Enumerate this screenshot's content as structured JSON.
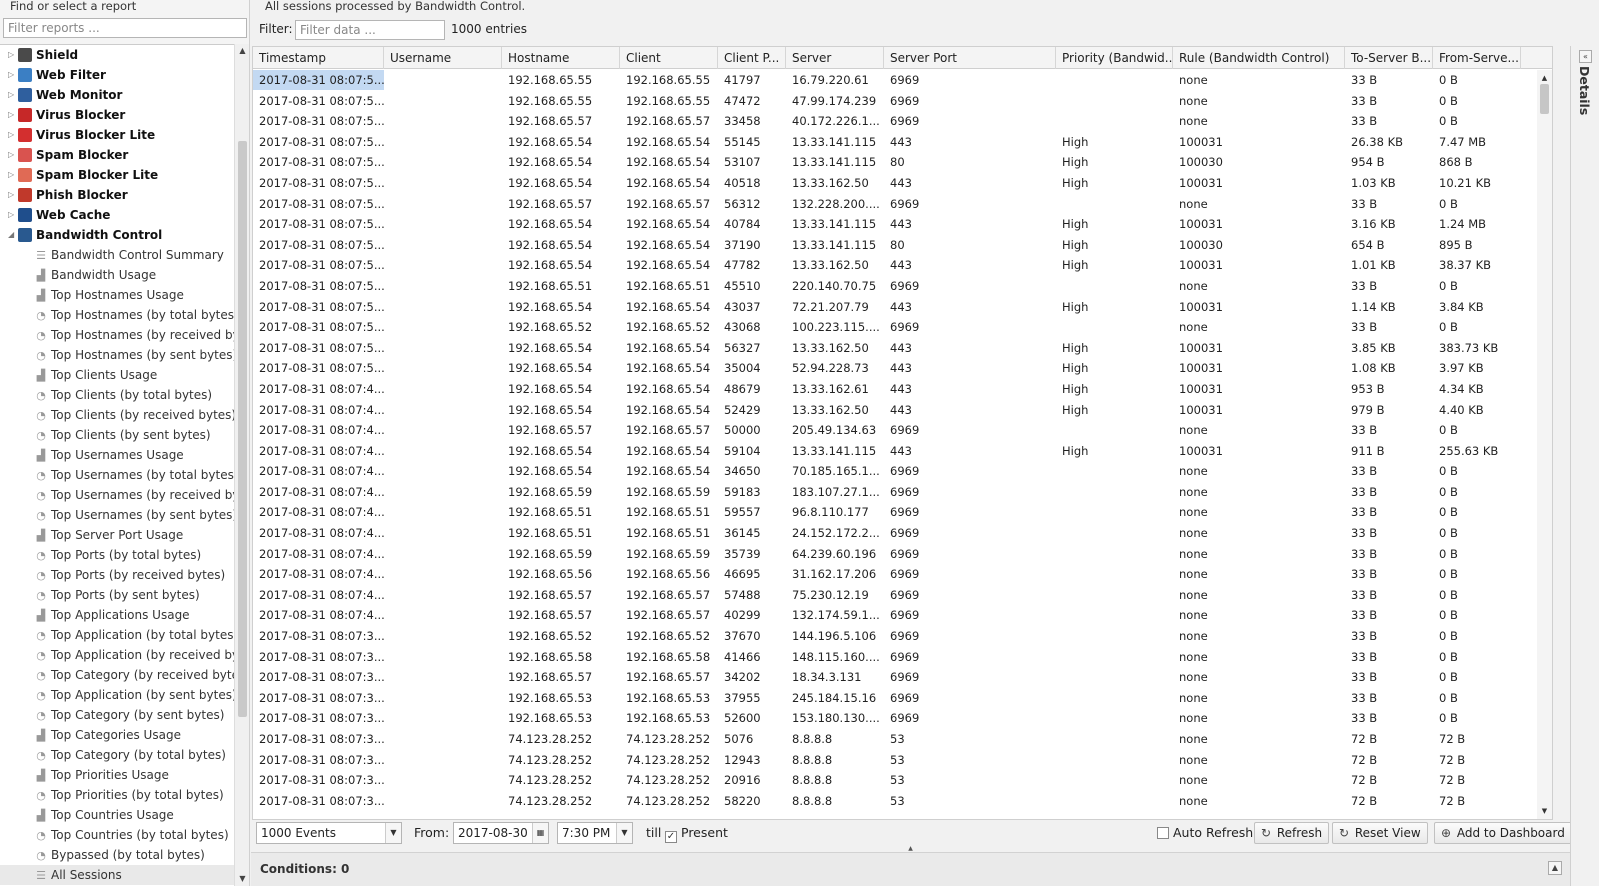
{
  "sidebar": {
    "find_label": "Find or select a report",
    "filter_placeholder": "Filter reports ...",
    "apps": [
      {
        "name": "Shield",
        "color": "#4a4a4a",
        "expanded": false
      },
      {
        "name": "Web Filter",
        "color": "#3b7fc4",
        "expanded": false
      },
      {
        "name": "Web Monitor",
        "color": "#2f5f9e",
        "expanded": false
      },
      {
        "name": "Virus Blocker",
        "color": "#c62828",
        "expanded": false
      },
      {
        "name": "Virus Blocker Lite",
        "color": "#d32f2f",
        "expanded": false
      },
      {
        "name": "Spam Blocker",
        "color": "#d9534f",
        "expanded": false
      },
      {
        "name": "Spam Blocker Lite",
        "color": "#e06a55",
        "expanded": false
      },
      {
        "name": "Phish Blocker",
        "color": "#c0392b",
        "expanded": false
      },
      {
        "name": "Web Cache",
        "color": "#1f4e8c",
        "expanded": false
      },
      {
        "name": "Bandwidth Control",
        "color": "#29598f",
        "expanded": true
      }
    ],
    "reports": [
      {
        "label": "Bandwidth Control Summary",
        "icon": "list-icon"
      },
      {
        "label": "Bandwidth Usage",
        "icon": "area-chart-icon"
      },
      {
        "label": "Top Hostnames Usage",
        "icon": "area-chart-icon"
      },
      {
        "label": "Top Hostnames (by total bytes)",
        "icon": "pie-chart-icon"
      },
      {
        "label": "Top Hostnames (by received byte...",
        "icon": "pie-chart-icon"
      },
      {
        "label": "Top Hostnames (by sent bytes)",
        "icon": "pie-chart-icon"
      },
      {
        "label": "Top Clients Usage",
        "icon": "area-chart-icon"
      },
      {
        "label": "Top Clients (by total bytes)",
        "icon": "pie-chart-icon"
      },
      {
        "label": "Top Clients (by received bytes)",
        "icon": "pie-chart-icon"
      },
      {
        "label": "Top Clients (by sent bytes)",
        "icon": "pie-chart-icon"
      },
      {
        "label": "Top Usernames Usage",
        "icon": "area-chart-icon"
      },
      {
        "label": "Top Usernames (by total bytes)",
        "icon": "pie-chart-icon"
      },
      {
        "label": "Top Usernames (by received bytes)",
        "icon": "pie-chart-icon"
      },
      {
        "label": "Top Usernames (by sent bytes)",
        "icon": "pie-chart-icon"
      },
      {
        "label": "Top Server Port Usage",
        "icon": "area-chart-icon"
      },
      {
        "label": "Top Ports (by total bytes)",
        "icon": "pie-chart-icon"
      },
      {
        "label": "Top Ports (by received bytes)",
        "icon": "pie-chart-icon"
      },
      {
        "label": "Top Ports (by sent bytes)",
        "icon": "pie-chart-icon"
      },
      {
        "label": "Top Applications Usage",
        "icon": "area-chart-icon"
      },
      {
        "label": "Top Application (by total bytes)",
        "icon": "pie-chart-icon"
      },
      {
        "label": "Top Application (by received bytes)",
        "icon": "pie-chart-icon"
      },
      {
        "label": "Top Category (by received bytes)",
        "icon": "pie-chart-icon"
      },
      {
        "label": "Top Application (by sent bytes)",
        "icon": "pie-chart-icon"
      },
      {
        "label": "Top Category (by sent bytes)",
        "icon": "pie-chart-icon"
      },
      {
        "label": "Top Categories Usage",
        "icon": "area-chart-icon"
      },
      {
        "label": "Top Category (by total bytes)",
        "icon": "pie-chart-icon"
      },
      {
        "label": "Top Priorities Usage",
        "icon": "area-chart-icon"
      },
      {
        "label": "Top Priorities (by total bytes)",
        "icon": "pie-chart-icon"
      },
      {
        "label": "Top Countries Usage",
        "icon": "area-chart-icon"
      },
      {
        "label": "Top Countries (by total bytes)",
        "icon": "pie-chart-icon"
      },
      {
        "label": "Bypassed (by total bytes)",
        "icon": "pie-chart-icon"
      },
      {
        "label": "All Sessions",
        "icon": "list-icon",
        "selected": true
      }
    ]
  },
  "main": {
    "description": "All sessions processed by Bandwidth Control.",
    "filter_label": "Filter:",
    "filter_placeholder": "Filter data ...",
    "entries": "1000 entries"
  },
  "table": {
    "columns": [
      "Timestamp",
      "Username",
      "Hostname",
      "Client",
      "Client P...",
      "Server",
      "Server Port",
      "Priority (Bandwid...",
      "Rule (Bandwidth Control)",
      "To-Server B...",
      "From-Serve..."
    ],
    "rows": [
      [
        "2017-08-31 08:07:5...",
        "",
        "192.168.65.55",
        "192.168.65.55",
        "41797",
        "16.79.220.61",
        "6969",
        "",
        "none",
        "33 B",
        "0 B"
      ],
      [
        "2017-08-31 08:07:5...",
        "",
        "192.168.65.55",
        "192.168.65.55",
        "47472",
        "47.99.174.239",
        "6969",
        "",
        "none",
        "33 B",
        "0 B"
      ],
      [
        "2017-08-31 08:07:5...",
        "",
        "192.168.65.57",
        "192.168.65.57",
        "33458",
        "40.172.226.1...",
        "6969",
        "",
        "none",
        "33 B",
        "0 B"
      ],
      [
        "2017-08-31 08:07:5...",
        "",
        "192.168.65.54",
        "192.168.65.54",
        "55145",
        "13.33.141.115",
        "443",
        "High",
        "100031",
        "26.38 KB",
        "7.47 MB"
      ],
      [
        "2017-08-31 08:07:5...",
        "",
        "192.168.65.54",
        "192.168.65.54",
        "53107",
        "13.33.141.115",
        "80",
        "High",
        "100030",
        "954 B",
        "868 B"
      ],
      [
        "2017-08-31 08:07:5...",
        "",
        "192.168.65.54",
        "192.168.65.54",
        "40518",
        "13.33.162.50",
        "443",
        "High",
        "100031",
        "1.03 KB",
        "10.21 KB"
      ],
      [
        "2017-08-31 08:07:5...",
        "",
        "192.168.65.57",
        "192.168.65.57",
        "56312",
        "132.228.200....",
        "6969",
        "",
        "none",
        "33 B",
        "0 B"
      ],
      [
        "2017-08-31 08:07:5...",
        "",
        "192.168.65.54",
        "192.168.65.54",
        "40784",
        "13.33.141.115",
        "443",
        "High",
        "100031",
        "3.16 KB",
        "1.24 MB"
      ],
      [
        "2017-08-31 08:07:5...",
        "",
        "192.168.65.54",
        "192.168.65.54",
        "37190",
        "13.33.141.115",
        "80",
        "High",
        "100030",
        "654 B",
        "895 B"
      ],
      [
        "2017-08-31 08:07:5...",
        "",
        "192.168.65.54",
        "192.168.65.54",
        "47782",
        "13.33.162.50",
        "443",
        "High",
        "100031",
        "1.01 KB",
        "38.37 KB"
      ],
      [
        "2017-08-31 08:07:5...",
        "",
        "192.168.65.51",
        "192.168.65.51",
        "45510",
        "220.140.70.75",
        "6969",
        "",
        "none",
        "33 B",
        "0 B"
      ],
      [
        "2017-08-31 08:07:5...",
        "",
        "192.168.65.54",
        "192.168.65.54",
        "43037",
        "72.21.207.79",
        "443",
        "High",
        "100031",
        "1.14 KB",
        "3.84 KB"
      ],
      [
        "2017-08-31 08:07:5...",
        "",
        "192.168.65.52",
        "192.168.65.52",
        "43068",
        "100.223.115....",
        "6969",
        "",
        "none",
        "33 B",
        "0 B"
      ],
      [
        "2017-08-31 08:07:5...",
        "",
        "192.168.65.54",
        "192.168.65.54",
        "56327",
        "13.33.162.50",
        "443",
        "High",
        "100031",
        "3.85 KB",
        "383.73 KB"
      ],
      [
        "2017-08-31 08:07:5...",
        "",
        "192.168.65.54",
        "192.168.65.54",
        "35004",
        "52.94.228.73",
        "443",
        "High",
        "100031",
        "1.08 KB",
        "3.97 KB"
      ],
      [
        "2017-08-31 08:07:4...",
        "",
        "192.168.65.54",
        "192.168.65.54",
        "48679",
        "13.33.162.61",
        "443",
        "High",
        "100031",
        "953 B",
        "4.34 KB"
      ],
      [
        "2017-08-31 08:07:4...",
        "",
        "192.168.65.54",
        "192.168.65.54",
        "52429",
        "13.33.162.50",
        "443",
        "High",
        "100031",
        "979 B",
        "4.40 KB"
      ],
      [
        "2017-08-31 08:07:4...",
        "",
        "192.168.65.57",
        "192.168.65.57",
        "50000",
        "205.49.134.63",
        "6969",
        "",
        "none",
        "33 B",
        "0 B"
      ],
      [
        "2017-08-31 08:07:4...",
        "",
        "192.168.65.54",
        "192.168.65.54",
        "59104",
        "13.33.141.115",
        "443",
        "High",
        "100031",
        "911 B",
        "255.63 KB"
      ],
      [
        "2017-08-31 08:07:4...",
        "",
        "192.168.65.54",
        "192.168.65.54",
        "34650",
        "70.185.165.1...",
        "6969",
        "",
        "none",
        "33 B",
        "0 B"
      ],
      [
        "2017-08-31 08:07:4...",
        "",
        "192.168.65.59",
        "192.168.65.59",
        "59183",
        "183.107.27.1...",
        "6969",
        "",
        "none",
        "33 B",
        "0 B"
      ],
      [
        "2017-08-31 08:07:4...",
        "",
        "192.168.65.51",
        "192.168.65.51",
        "59557",
        "96.8.110.177",
        "6969",
        "",
        "none",
        "33 B",
        "0 B"
      ],
      [
        "2017-08-31 08:07:4...",
        "",
        "192.168.65.51",
        "192.168.65.51",
        "36145",
        "24.152.172.2...",
        "6969",
        "",
        "none",
        "33 B",
        "0 B"
      ],
      [
        "2017-08-31 08:07:4...",
        "",
        "192.168.65.59",
        "192.168.65.59",
        "35739",
        "64.239.60.196",
        "6969",
        "",
        "none",
        "33 B",
        "0 B"
      ],
      [
        "2017-08-31 08:07:4...",
        "",
        "192.168.65.56",
        "192.168.65.56",
        "46695",
        "31.162.17.206",
        "6969",
        "",
        "none",
        "33 B",
        "0 B"
      ],
      [
        "2017-08-31 08:07:4...",
        "",
        "192.168.65.57",
        "192.168.65.57",
        "57488",
        "75.230.12.19",
        "6969",
        "",
        "none",
        "33 B",
        "0 B"
      ],
      [
        "2017-08-31 08:07:4...",
        "",
        "192.168.65.57",
        "192.168.65.57",
        "40299",
        "132.174.59.1...",
        "6969",
        "",
        "none",
        "33 B",
        "0 B"
      ],
      [
        "2017-08-31 08:07:3...",
        "",
        "192.168.65.52",
        "192.168.65.52",
        "37670",
        "144.196.5.106",
        "6969",
        "",
        "none",
        "33 B",
        "0 B"
      ],
      [
        "2017-08-31 08:07:3...",
        "",
        "192.168.65.58",
        "192.168.65.58",
        "41466",
        "148.115.160....",
        "6969",
        "",
        "none",
        "33 B",
        "0 B"
      ],
      [
        "2017-08-31 08:07:3...",
        "",
        "192.168.65.57",
        "192.168.65.57",
        "34202",
        "18.34.3.131",
        "6969",
        "",
        "none",
        "33 B",
        "0 B"
      ],
      [
        "2017-08-31 08:07:3...",
        "",
        "192.168.65.53",
        "192.168.65.53",
        "37955",
        "245.184.15.16",
        "6969",
        "",
        "none",
        "33 B",
        "0 B"
      ],
      [
        "2017-08-31 08:07:3...",
        "",
        "192.168.65.53",
        "192.168.65.53",
        "52600",
        "153.180.130....",
        "6969",
        "",
        "none",
        "33 B",
        "0 B"
      ],
      [
        "2017-08-31 08:07:3...",
        "",
        "74.123.28.252",
        "74.123.28.252",
        "5076",
        "8.8.8.8",
        "53",
        "",
        "none",
        "72 B",
        "72 B"
      ],
      [
        "2017-08-31 08:07:3...",
        "",
        "74.123.28.252",
        "74.123.28.252",
        "12943",
        "8.8.8.8",
        "53",
        "",
        "none",
        "72 B",
        "72 B"
      ],
      [
        "2017-08-31 08:07:3...",
        "",
        "74.123.28.252",
        "74.123.28.252",
        "20916",
        "8.8.8.8",
        "53",
        "",
        "none",
        "72 B",
        "72 B"
      ],
      [
        "2017-08-31 08:07:3...",
        "",
        "74.123.28.252",
        "74.123.28.252",
        "58220",
        "8.8.8.8",
        "53",
        "",
        "none",
        "72 B",
        "72 B"
      ]
    ]
  },
  "toolbar": {
    "events_select": "1000 Events",
    "from_label": "From:",
    "from_date": "2017-08-30",
    "from_time": "7:30 PM",
    "till_label": "till",
    "present_label": "Present",
    "present_checked": true,
    "auto_refresh_label": "Auto Refresh",
    "auto_refresh_checked": false,
    "refresh_label": "Refresh",
    "reset_view_label": "Reset View",
    "add_dashboard_label": "Add to Dashboard"
  },
  "conditions": {
    "label": "Conditions: 0"
  },
  "details": {
    "label": "Details"
  },
  "colors": {
    "selection": "#c3d9f2",
    "header_bg": "#f4f4f4"
  }
}
